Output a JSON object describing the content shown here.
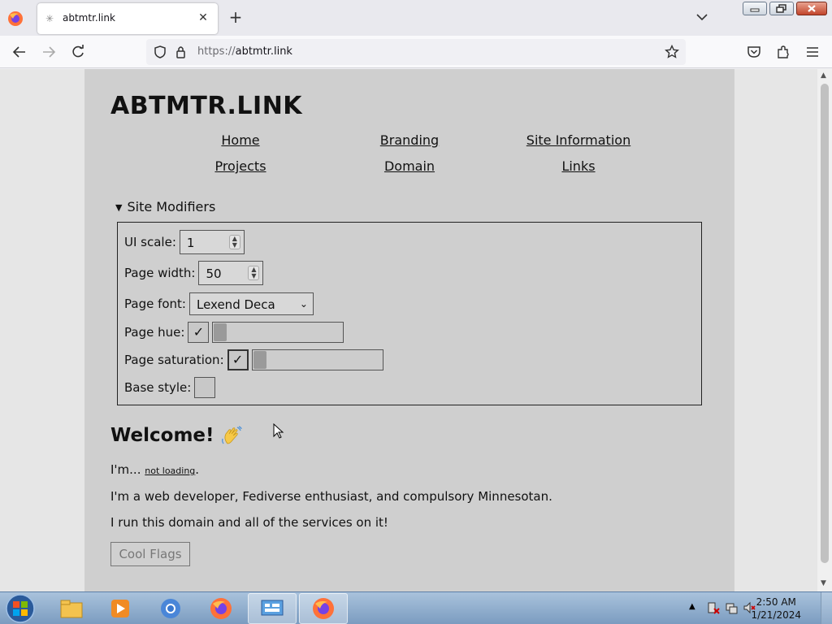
{
  "browser": {
    "tab_title": "abtmtr.link",
    "url_scheme": "https://",
    "url_host": "abtmtr.link"
  },
  "site": {
    "title": "ABTMTR.LINK",
    "nav": [
      "Home",
      "Branding",
      "Site Information",
      "Projects",
      "Domain",
      "Links"
    ],
    "modifiers": {
      "summary": "Site Modifiers",
      "ui_scale_label": "UI scale:",
      "ui_scale_value": "1",
      "page_width_label": "Page width:",
      "page_width_value": "50",
      "page_font_label": "Page font:",
      "page_font_value": "Lexend Deca",
      "page_hue_label": "Page hue:",
      "page_hue_checked": true,
      "page_hue_level": 0,
      "page_saturation_label": "Page saturation:",
      "page_saturation_checked": true,
      "page_saturation_level": 0,
      "base_style_label": "Base style:",
      "base_style_checked": false,
      "check_glyph": "✓"
    },
    "welcome_heading": "Welcome!",
    "im_prefix": "I'm...",
    "im_link": "not loading",
    "im_suffix": ".",
    "line1": "I'm a web developer, Fediverse enthusiast, and compulsory Minnesotan.",
    "line2": "I run this domain and all of the services on it!",
    "cool_flags_button": "Cool Flags"
  },
  "taskbar": {
    "time": "2:50 AM",
    "date": "1/21/2024"
  },
  "icons": [
    "firefox-icon",
    "close-icon",
    "plus-icon",
    "chevron-down-icon",
    "back-icon",
    "forward-icon",
    "reload-icon",
    "shield-icon",
    "lock-icon",
    "star-icon",
    "pocket-icon",
    "extensions-icon",
    "menu-icon",
    "wave-emoji-icon",
    "windows-start-icon",
    "explorer-icon",
    "media-player-icon",
    "chrome-icon",
    "control-panel-icon"
  ]
}
